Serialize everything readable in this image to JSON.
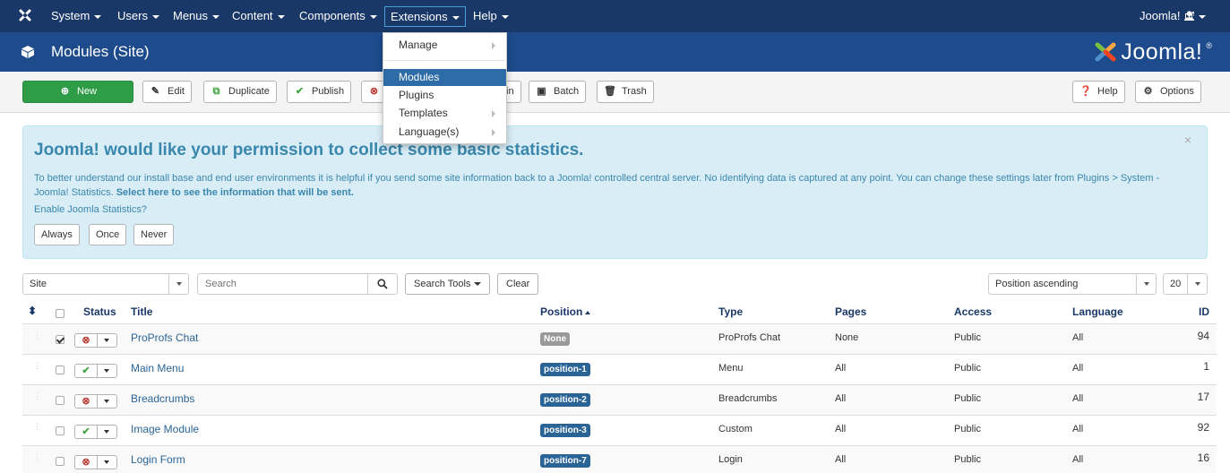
{
  "nav": {
    "items": [
      {
        "label": "System"
      },
      {
        "label": "Users"
      },
      {
        "label": "Menus"
      },
      {
        "label": "Content"
      },
      {
        "label": "Components"
      },
      {
        "label": "Extensions"
      },
      {
        "label": "Help"
      }
    ],
    "site_link": "Joomla!",
    "colors": {
      "navbar": "#1a3867",
      "header": "#1d4b8c"
    }
  },
  "header": {
    "title": "Modules (Site)",
    "brand": "Joomla!"
  },
  "extensions_menu": {
    "items": [
      {
        "label": "Manage",
        "has_sub": true
      },
      {
        "label": "Modules",
        "has_sub": false,
        "selected": true
      },
      {
        "label": "Plugins",
        "has_sub": false
      },
      {
        "label": "Templates",
        "has_sub": true
      },
      {
        "label": "Language(s)",
        "has_sub": true
      }
    ]
  },
  "toolbar": {
    "new": "New",
    "edit": "Edit",
    "duplicate": "Duplicate",
    "publish": "Publish",
    "checkin_partial": "in",
    "batch": "Batch",
    "trash": "Trash",
    "help": "Help",
    "options": "Options"
  },
  "stats": {
    "heading": "Joomla! would like your permission to collect some basic statistics.",
    "body": "To better understand our install base and end user environments it is helpful if you send some site information back to a Joomla! controlled central server. No identifying data is captured at any point. You can change these settings later from Plugins > System - Joomla! Statistics.",
    "link": "Select here to see the information that will be sent.",
    "question": "Enable Joomla Statistics?",
    "buttons": {
      "always": "Always",
      "once": "Once",
      "never": "Never"
    },
    "close": "×"
  },
  "filters": {
    "client": "Site",
    "search_placeholder": "Search",
    "search_tools": "Search Tools",
    "clear": "Clear",
    "ordering": "Position ascending",
    "limit": "20"
  },
  "table": {
    "columns": {
      "status": "Status",
      "title": "Title",
      "position": "Position",
      "type": "Type",
      "pages": "Pages",
      "access": "Access",
      "language": "Language",
      "id": "ID"
    },
    "rows": [
      {
        "checked": true,
        "published": false,
        "title": "ProProfs Chat",
        "position": "None",
        "type": "ProProfs Chat",
        "pages": "None",
        "access": "Public",
        "language": "All",
        "id": "94"
      },
      {
        "checked": false,
        "published": true,
        "title": "Main Menu",
        "position": "position-1",
        "type": "Menu",
        "pages": "All",
        "access": "Public",
        "language": "All",
        "id": "1"
      },
      {
        "checked": false,
        "published": false,
        "title": "Breadcrumbs",
        "position": "position-2",
        "type": "Breadcrumbs",
        "pages": "All",
        "access": "Public",
        "language": "All",
        "id": "17"
      },
      {
        "checked": false,
        "published": true,
        "title": "Image Module",
        "position": "position-3",
        "type": "Custom",
        "pages": "All",
        "access": "Public",
        "language": "All",
        "id": "92"
      },
      {
        "checked": false,
        "published": false,
        "title": "Login Form",
        "position": "position-7",
        "type": "Login",
        "pages": "All",
        "access": "Public",
        "language": "All",
        "id": "16"
      }
    ]
  }
}
